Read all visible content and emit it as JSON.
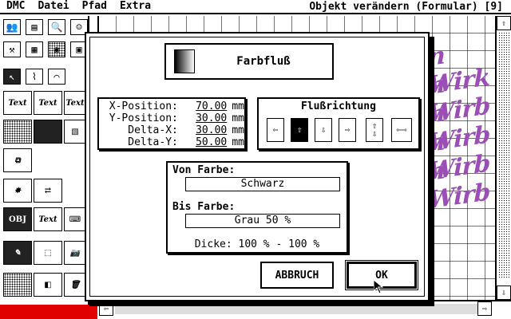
{
  "menubar": {
    "items": [
      "DMC",
      "Datei",
      "Pfad",
      "Extra"
    ],
    "status": "Objekt verändern (Formular) [9]"
  },
  "toolbox": {
    "text_tools": [
      "Text",
      "Text",
      "Text",
      "Text"
    ],
    "obj_label": "OBJ"
  },
  "canvas": {
    "art_lines": [
      "n Wirk",
      "n Wirb",
      "n Wirb",
      "n Wirb",
      "n Wirb"
    ]
  },
  "dialog": {
    "title": "Farbfluß",
    "position": {
      "rows": [
        {
          "label": "X-Position:",
          "value": "70.00",
          "unit": "mm"
        },
        {
          "label": "Y-Position:",
          "value": "30.00",
          "unit": "mm"
        },
        {
          "label": "Delta-X:",
          "value": "30.00",
          "unit": "mm"
        },
        {
          "label": "Delta-Y:",
          "value": "50.00",
          "unit": "mm"
        }
      ]
    },
    "flow_direction": {
      "title": "Flußrichtung",
      "selected_index": 1
    },
    "colors": {
      "from_label": "Von Farbe:",
      "from_value": "Schwarz",
      "to_label": "Bis Farbe:",
      "to_value": "Grau 50 %",
      "thickness": "Dicke: 100 % - 100 %"
    },
    "cancel_label": "ABBRUCH",
    "ok_label": "OK"
  },
  "colors": {
    "wordart": "#9b4fb6",
    "bottom_bar": "#e00000"
  }
}
